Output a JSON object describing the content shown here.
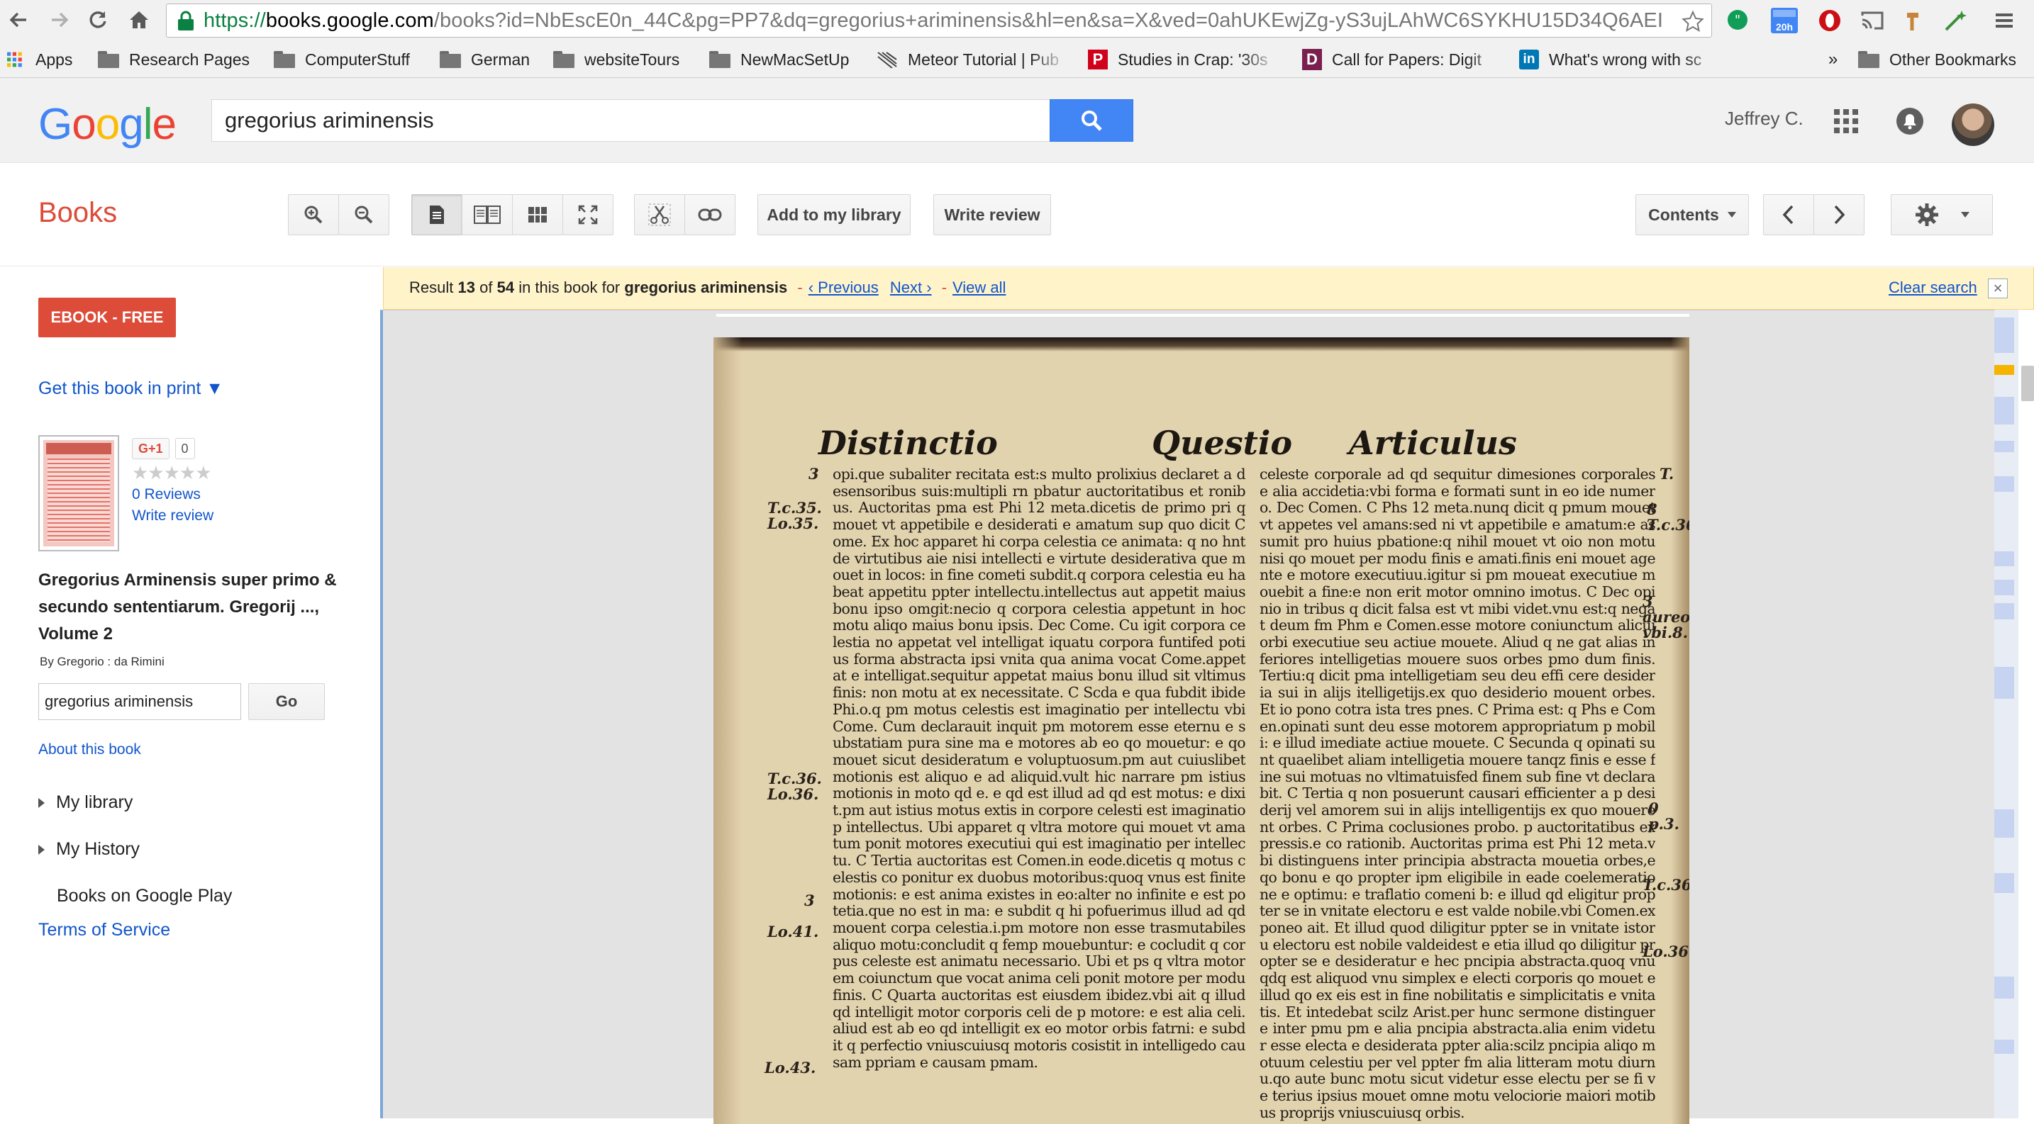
{
  "browser": {
    "url_scheme": "https://",
    "url_host": "books.google.com",
    "url_rest": "/books?id=NbEscE0n_44C&pg=PP7&dq=gregorius+ariminensis&hl=en&sa=X&ved=0ahUKEwjZg-yS3ujLAhWC6SYKHU15D34Q6AEI...",
    "calendar_badge": "20h"
  },
  "bookmarks": {
    "apps": "Apps",
    "items": [
      "Research Pages",
      "ComputerStuff",
      "German",
      "websiteTours",
      "NewMacSetUp",
      "Meteor Tutorial | Pub",
      "Studies in Crap: '30s",
      "Call for Papers: Digit",
      "What's wrong with sc"
    ],
    "more": "»",
    "other": "Other Bookmarks"
  },
  "header": {
    "logo_letters": [
      "G",
      "o",
      "o",
      "g",
      "l",
      "e"
    ],
    "logo_colors": [
      "#4285f4",
      "#ea4335",
      "#fbbc05",
      "#4285f4",
      "#34a853",
      "#ea4335"
    ],
    "search_value": "gregorius ariminensis",
    "user_name": "Jeffrey C."
  },
  "books_toolbar": {
    "title": "Books",
    "add_library": "Add to my library",
    "write_review": "Write review",
    "contents": "Contents"
  },
  "sidebar": {
    "ebook": "EBOOK - FREE",
    "get_print": "Get this book in print ▼",
    "gplus": "G+1",
    "gplus_count": "0",
    "stars": "★★★★★",
    "reviews": "0 Reviews",
    "write_review": "Write review",
    "book_title": "Gregorius Arminensis super primo & secundo sententiarum. Gregorij ..., Volume 2",
    "byline": "By Gregorio : da Rimini",
    "inbook_value": "gregorius ariminensis",
    "go": "Go",
    "about": "About this book",
    "my_library": "My library",
    "my_history": "My History",
    "books_play": "Books on Google Play",
    "terms": "Terms of Service"
  },
  "result": {
    "prefix": "Result",
    "current": "13",
    "of": "of",
    "total": "54",
    "middle": "in this book for",
    "query": "gregorius ariminensis",
    "previous": "‹ Previous",
    "next": "Next ›",
    "view_all": "View all",
    "clear": "Clear search",
    "close": "×"
  },
  "scan": {
    "head_left": "Distinctio",
    "head_mid": "Questio",
    "head_right": "Articulus",
    "col_left": "opi.que subaliter recitata est:s multo prolixius declaret a desensoribus suis:multipli rn pbatur auctoritatibus et ronibus. Auctoritas pma est Phi 12 meta.dicetis de primo pri q mouet vt appetibile e desiderati e amatum sup quo dicit Come. Ex hoc apparet hi corpa celestia ce animata: q no hnt de virtutibus aie nisi intellecti e virtute desiderativa que mouet in locos: in fine cometi subdit.q corpora celestia eu habeat appetitu ppter intellectu.intellectus aut appetit maius bonu ipso omgit:necio q corpora celestia appetunt in hoc motu aliqo maius bonu ipsis. Dec Come. Cu igit corpora celestia no appetat vel intelligat iquatu corpora funtifed potius forma abstracta ipsi vnita qua anima vocat Come.appetat e intelligat.sequitur appetat maius bonu illud sit vltimus finis: non motu at ex necessitate. C Scda e qua fubdit ibide Phi.o.q pm motus celestis est imaginatio per intellectu vbi Come. Cum declarauit inquit pm motorem esse eternu e substatiam pura sine ma e motores ab eo qo mouetur: e qo mouet sicut desideratum e voluptuosum.pm aut cuiuslibet motionis est aliquo e ad aliquid.vult hic narrare pm istius motionis in moto qd e. e qd est illud ad qd est motus: e dixit.pm aut istius motus extis in corpore celesti est imaginatio p intellectus. Ubi apparet q vltra motore qui mouet vt amatum ponit motores executiui qui est imaginatio per intellectu. C Tertia auctoritas est Comen.in eode.dicetis q motus celestis co ponitur ex duobus motoribus:quoq vnus est finite motionis: e est anima existes in eo:alter no infinite e est potetia.que no est in ma: e subdit q hi pofuerimus illud ad qd mouent corpa celestia.i.pm motore non esse trasmutabiles aliquo motu:concludit q femp mouebuntur: e cocludit q corpus celeste est animatu necessario. Ubi et ps q vltra motorem coiunctum que vocat anima celi ponit motore per modu finis. C Quarta auctoritas est eiusdem ibidez.vbi ait q illud qd intelligit motor corporis celi de p motore: e est alia celi.aliud est ab eo qd intelligit ex eo motor orbis fatrni: e subdit q perfectio vniuscuiusq motoris cosistit in intelligedo causam ppriam e causam pmam.",
    "col_right": "celeste corporale ad qd sequitur dimesiones corporales e alia accidetia:vbi forma e formati sunt in eo ide numero. Dec Comen. C Phs 12 meta.nunq dicit q pmum mouet vt appetes vel amans:sed ni vt appetibile e amatum:e assumit pro huius pbatione:q nihil mouet vt oio non motu nisi qo mouet per modu finis e amati.finis eni mouet agente e motore executiuu.igitur si pm moueat executiue mouebit a fine:e non erit motor omnino imotus. C Dec opinio in tribus q dicit falsa est vt mibi videt.vnu est:q negat deum fm Phm e Comen.esse motore coniunctum alicui orbi executiue seu actiue mouete. Aliud q ne gat alias inferiores intelligetias mouere suos orbes pmo dum finis. Tertiu:q dicit pma intelligetiam seu deu effi cere desideria sui in alijs itelligetijs.ex quo desiderio mouent orbes. Et io pono cotra ista tres pnes. C Prima est: q Phs e Comen.opinati sunt deu esse motorem appropriatum p mobili: e illud imediate actiue mouete. C Secunda q opinati sunt quaelibet aliam intelligetia mouere tanqz finis e esse fine sui motuas no vltimatuisfed finem sub fine vt declarabit. C Tertia q non posuerunt causari efficienter a p desiderij vel amorem sui in alijs intelligentijs ex quo mouerent orbes. C Prima coclusiones probo. p auctoritatibus expressis.e co rationib. Auctoritas prima est Phi 12 meta.vbi distinguens inter principia abstracta mouetia orbes,e qo bonu e qo propter ipm eligibile in eade coelemeratione e optimu: e traflatio comeni b: e illud qd eligitur propter se in vnitate electoru e est valde nobile.vbi Comen.exponeo ait. Et illud quod diligitur ppter se in vnitate istoru electoru est nobile valdeidest e etia illud qo diligitur propter se e desideratur e hec pncipia abstracta.quoq vnuqdq est aliquod vnu simplex e electi corporis qo mouet e illud qo ex eis est in fine nobilitatis e simplicitatis e vnitatis. Et intedebat scilz Arist.per hunc sermone distinguere inter pmu pm e alia pncipia abstracta.alia enim videtur esse electa e desiderata ppter alia:scilz pncipia aliqo motuum celestiu per vel ppter fm alia litteram motu diurnu.qo aute bunc motu sicut videtur esse electu per se fi ve terius ipsius mouet omne motu velociorie maiori motibus proprijs vniuscuiusq orbis.",
    "marg_1": "3",
    "marg_2": "T.c.35. Lo.35.",
    "marg_3": "T.c.36. Lo.36.",
    "marg_4": "3",
    "marg_5": "Lo.41.",
    "marg_6": "Lo.43.",
    "marg_r1": "T.",
    "marg_r2": "8 T.c.36.",
    "marg_r3": "3 aureo. vbi.8.",
    "marg_r4": "0 p.3.",
    "marg_r5": "T.c.36.",
    "marg_r6": "Lo.36."
  },
  "scroll_marks": [
    {
      "top": 0.0,
      "h": 0.045
    },
    {
      "top": 0.06,
      "h": 0.012,
      "color": "#f4b400"
    },
    {
      "top": 0.1,
      "h": 0.035
    },
    {
      "top": 0.155,
      "h": 0.015
    },
    {
      "top": 0.2,
      "h": 0.02
    },
    {
      "top": 0.295,
      "h": 0.018
    },
    {
      "top": 0.33,
      "h": 0.02
    },
    {
      "top": 0.36,
      "h": 0.02
    },
    {
      "top": 0.44,
      "h": 0.04
    },
    {
      "top": 0.62,
      "h": 0.035
    },
    {
      "top": 0.7,
      "h": 0.025
    },
    {
      "top": 0.83,
      "h": 0.028
    },
    {
      "top": 0.91,
      "h": 0.018
    }
  ]
}
